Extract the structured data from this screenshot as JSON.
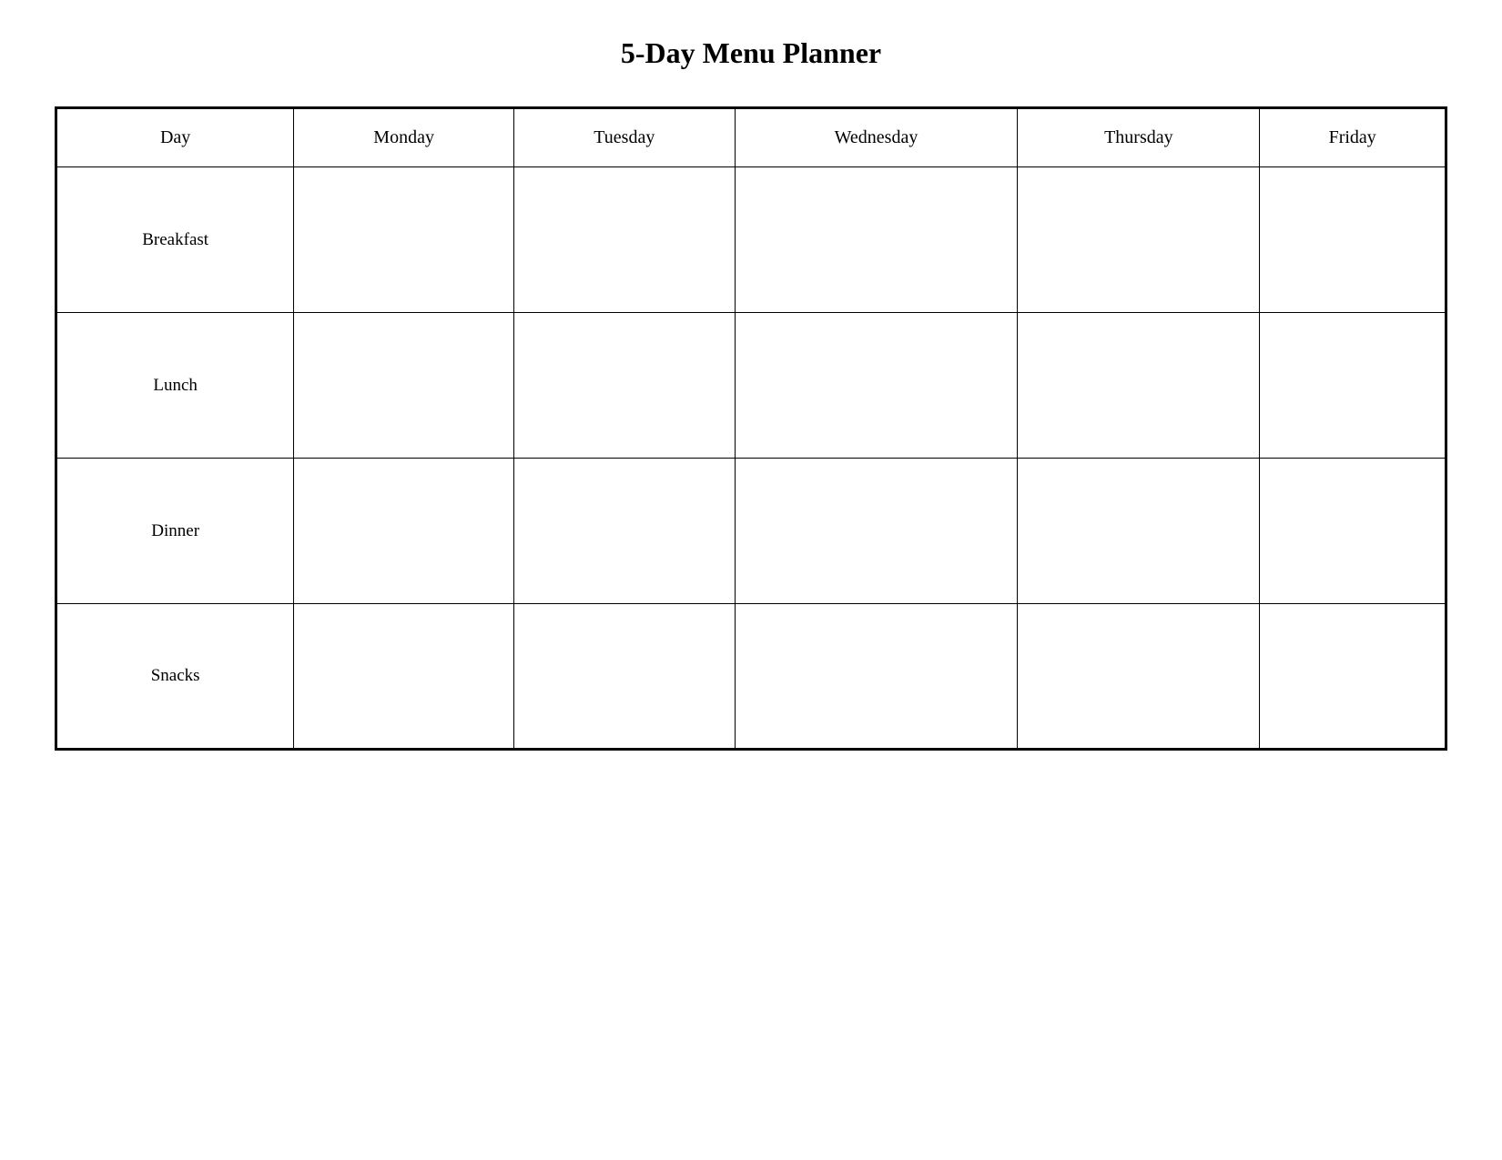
{
  "page": {
    "title": "5-Day Menu Planner"
  },
  "table": {
    "headers": {
      "day": "Day",
      "monday": "Monday",
      "tuesday": "Tuesday",
      "wednesday": "Wednesday",
      "thursday": "Thursday",
      "friday": "Friday"
    },
    "rows": [
      {
        "label": "Breakfast",
        "monday": "",
        "tuesday": "",
        "wednesday": "",
        "thursday": "",
        "friday": ""
      },
      {
        "label": "Lunch",
        "monday": "",
        "tuesday": "",
        "wednesday": "",
        "thursday": "",
        "friday": ""
      },
      {
        "label": "Dinner",
        "monday": "",
        "tuesday": "",
        "wednesday": "",
        "thursday": "",
        "friday": ""
      },
      {
        "label": "Snacks",
        "monday": "",
        "tuesday": "",
        "wednesday": "",
        "thursday": "",
        "friday": ""
      }
    ]
  }
}
